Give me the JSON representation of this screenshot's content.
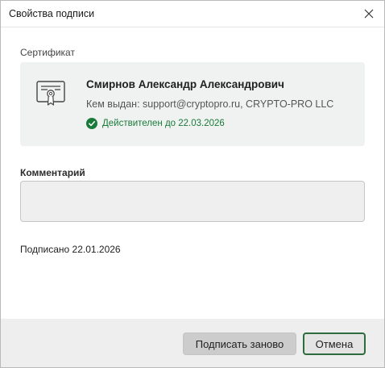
{
  "window": {
    "title": "Свойства подписи"
  },
  "certificate": {
    "section_label": "Сертификат",
    "owner_name": "Смирнов Александр Александрович",
    "issuer": "Кем выдан: support@cryptopro.ru, CRYPTO-PRO LLC",
    "validity": "Действителен до 22.03.2026",
    "validity_color": "#1a7a3a",
    "icon": "certificate-icon",
    "status_icon": "check-circle-icon"
  },
  "comment": {
    "label": "Комментарий",
    "value": "",
    "placeholder": ""
  },
  "signed": {
    "text": "Подписано 22.01.2026"
  },
  "footer": {
    "resign_label": "Подписать заново",
    "cancel_label": "Отмена",
    "accent_color": "#2e6b3e"
  }
}
